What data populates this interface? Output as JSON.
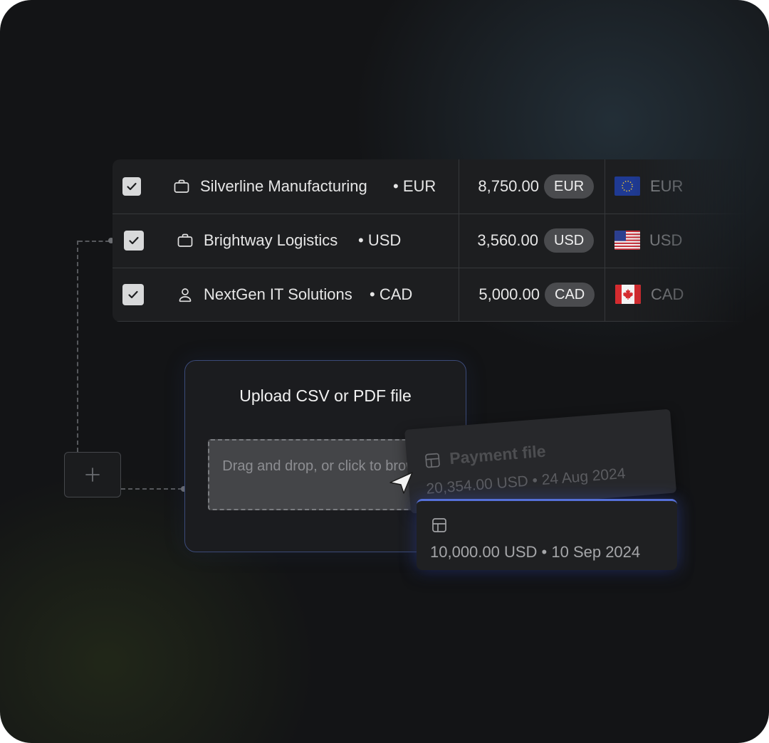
{
  "table": {
    "rows": [
      {
        "name": "Silverline Manufacturing",
        "currency_suffix": "• EUR",
        "amount": "8,750.00",
        "badge": "EUR",
        "flag_currency": "EUR",
        "icon": "briefcase-icon",
        "checked": true
      },
      {
        "name": "Brightway Logistics",
        "currency_suffix": "• USD",
        "amount": "3,560.00",
        "badge": "USD",
        "flag_currency": "USD",
        "icon": "briefcase-icon",
        "checked": true
      },
      {
        "name": "NextGen IT Solutions",
        "currency_suffix": "• CAD",
        "amount": "5,000.00",
        "badge": "CAD",
        "flag_currency": "CAD",
        "icon": "person-icon",
        "checked": true
      }
    ]
  },
  "upload": {
    "title": "Upload CSV or PDF file",
    "dropzone_text": "Drag and drop, or click to browse"
  },
  "files": {
    "back": {
      "title": "Payment file",
      "subtitle": "20,354.00 USD • 24 Aug 2024"
    },
    "front": {
      "subtitle": "10,000.00 USD • 10 Sep 2024"
    }
  },
  "colors": {
    "background": "#131416",
    "table_bg": "#1d1e20",
    "accent_blue": "#5570d8",
    "badge_bg": "#4a4b4e"
  }
}
